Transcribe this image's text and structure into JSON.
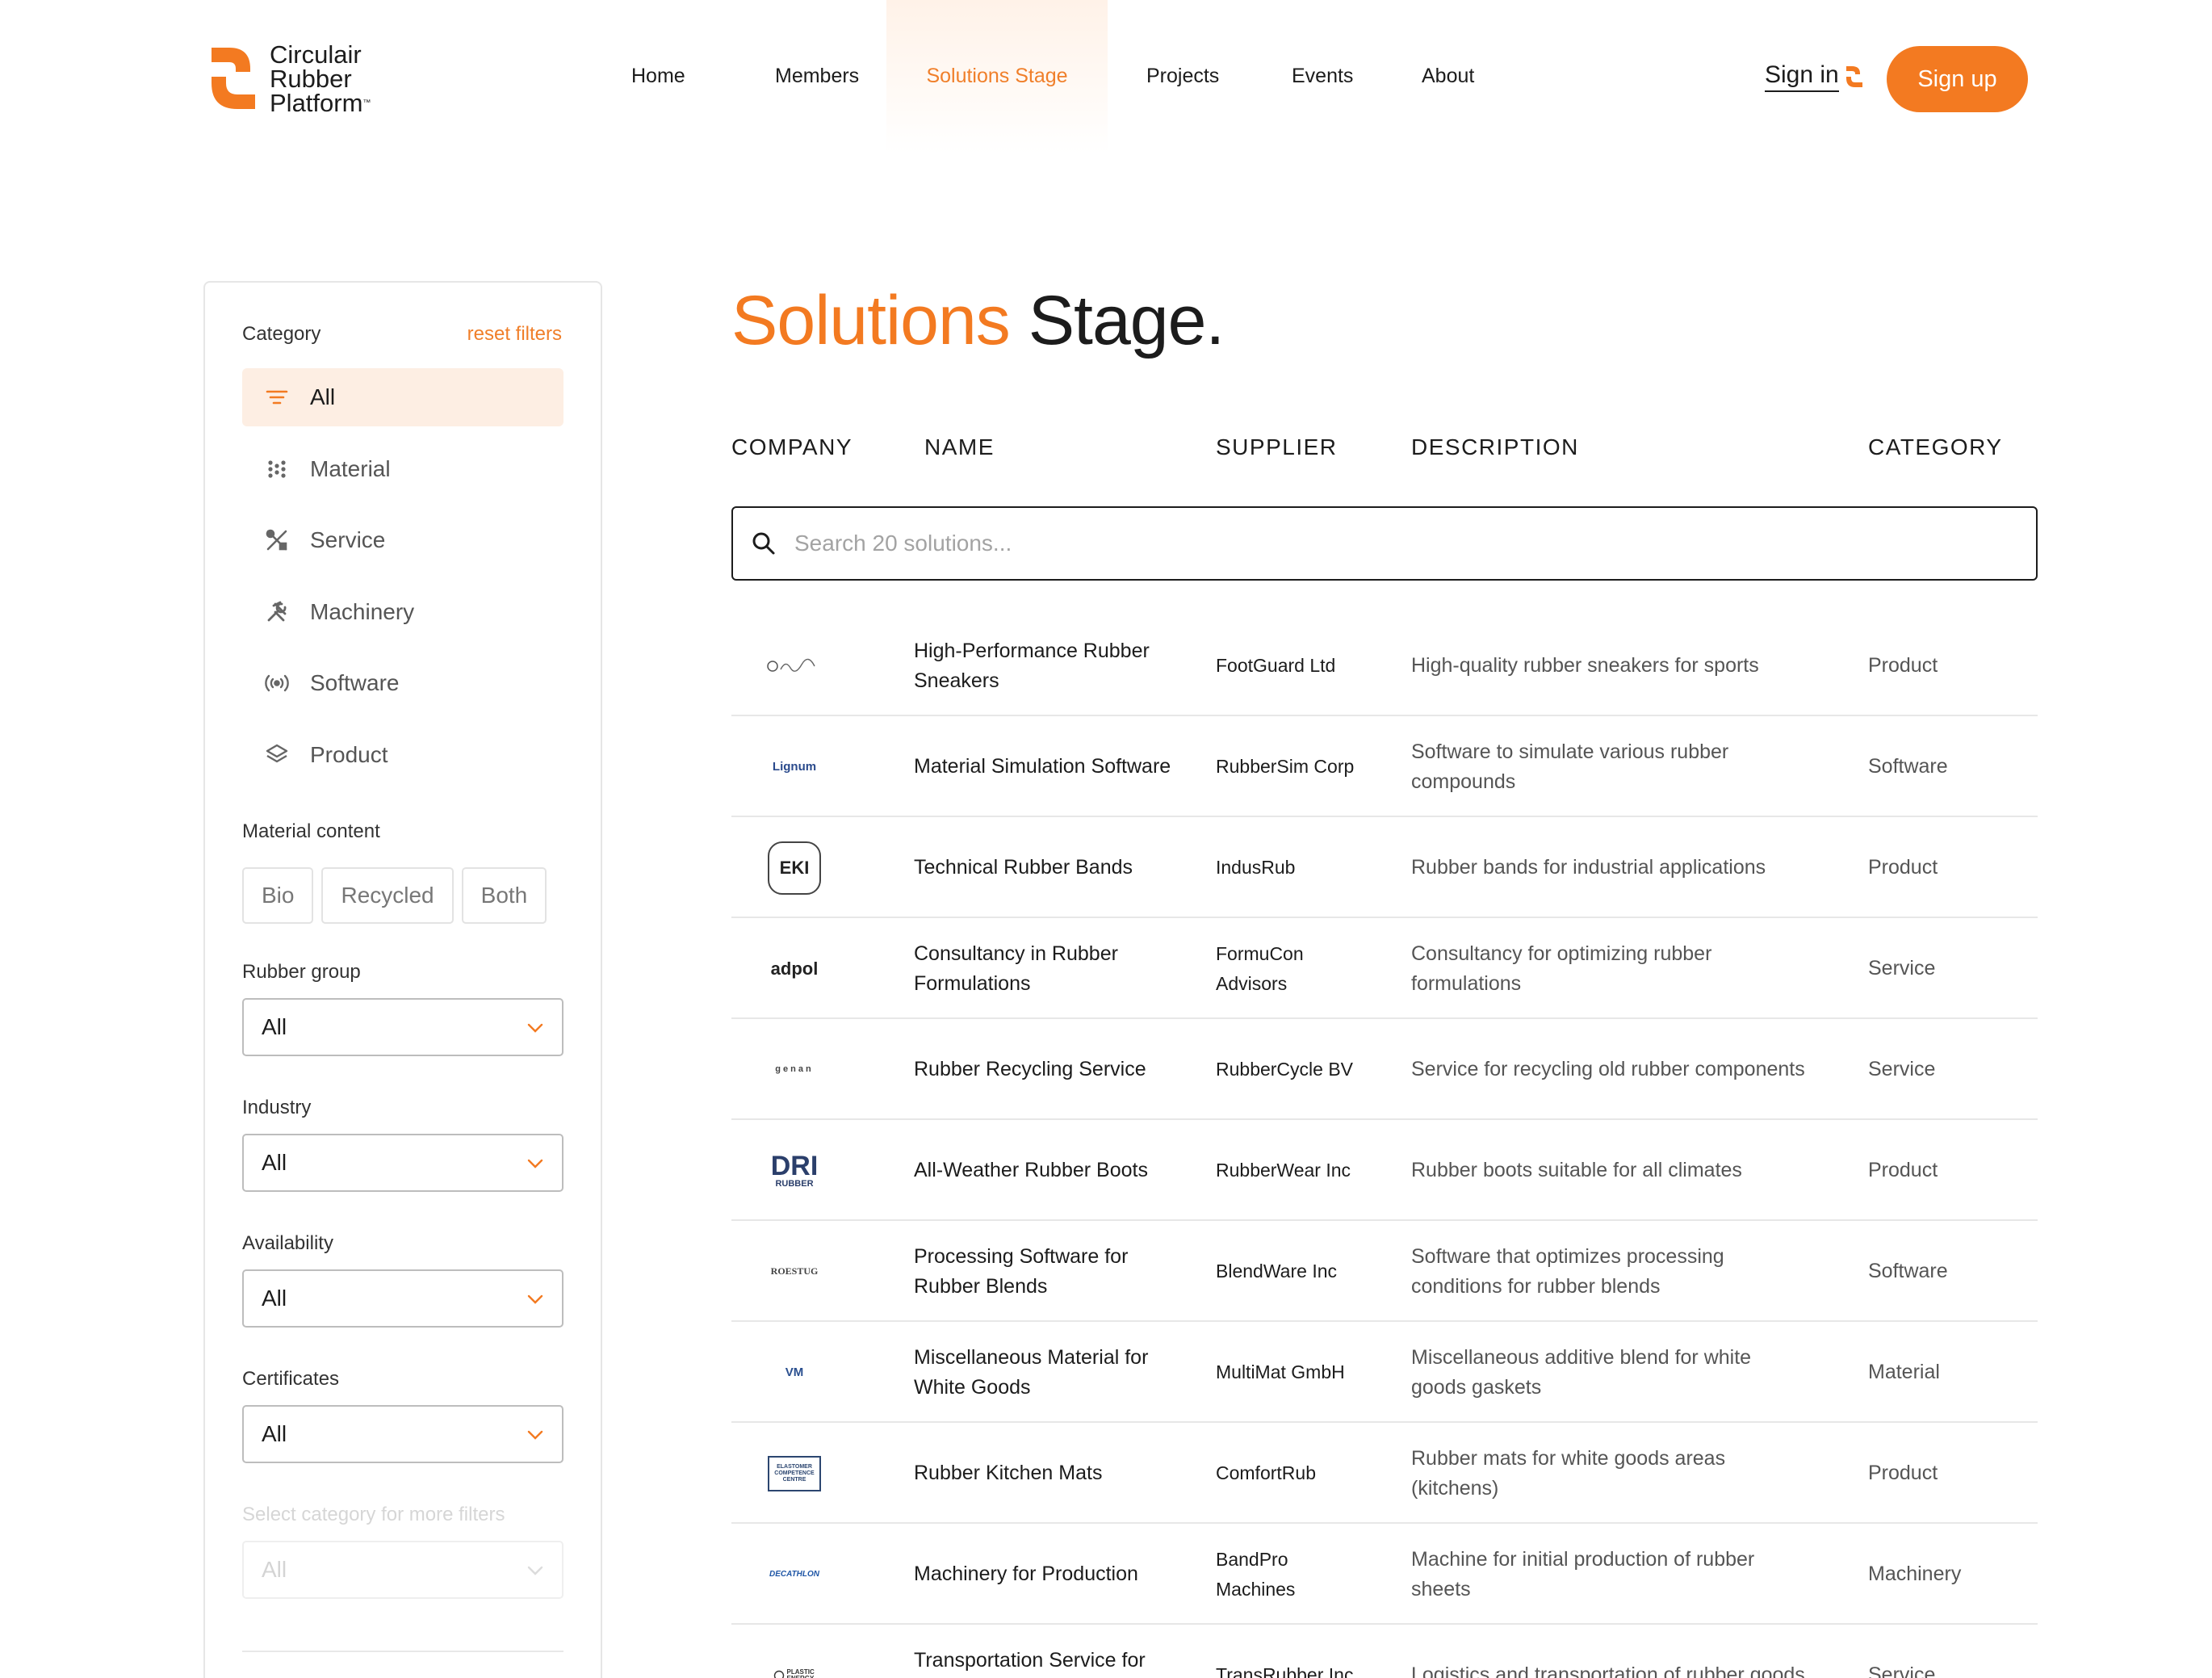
{
  "brand": {
    "line1": "Circulair",
    "line2": "Rubber",
    "line3": "Platform",
    "tm": "™",
    "accent": "#f37a21"
  },
  "nav": {
    "items": [
      {
        "label": "Home"
      },
      {
        "label": "Members"
      },
      {
        "label": "Solutions Stage",
        "active": true
      },
      {
        "label": "Projects"
      },
      {
        "label": "Events"
      },
      {
        "label": "About"
      }
    ],
    "sign_in": "Sign in",
    "sign_up": "Sign up"
  },
  "sidebar": {
    "category_label": "Category",
    "reset_label": "reset filters",
    "categories": [
      {
        "label": "All",
        "icon": "filter-lines-icon",
        "active": true
      },
      {
        "label": "Material",
        "icon": "dots-grid-icon"
      },
      {
        "label": "Service",
        "icon": "tools-crossed-icon"
      },
      {
        "label": "Machinery",
        "icon": "hammer-wrench-icon"
      },
      {
        "label": "Software",
        "icon": "broadcast-icon"
      },
      {
        "label": "Product",
        "icon": "layers-icon"
      }
    ],
    "material_content_label": "Material content",
    "material_options": [
      "Bio",
      "Recycled",
      "Both"
    ],
    "rubber_group": {
      "label": "Rubber group",
      "value": "All"
    },
    "industry": {
      "label": "Industry",
      "value": "All"
    },
    "availability": {
      "label": "Availability",
      "value": "All"
    },
    "certificates": {
      "label": "Certificates",
      "value": "All"
    },
    "more_filters": {
      "label": "Select category for more filters",
      "value": "All"
    }
  },
  "main": {
    "title_accent": "Solutions",
    "title_rest": " Stage.",
    "columns": [
      "COMPANY",
      "NAME",
      "SUPPLIER",
      "DESCRIPTION",
      "CATEGORY"
    ],
    "search_placeholder": "Search 20 solutions...",
    "rows": [
      {
        "logo": "signature-logo",
        "name": "High-Performance Rubber Sneakers",
        "supplier": "FootGuard Ltd",
        "description": "High-quality rubber sneakers for sports",
        "category": "Product"
      },
      {
        "logo": "lignum-logo",
        "logo_text": "Lignum",
        "name": "Material Simulation Software",
        "supplier": "RubberSim Corp",
        "description": "Software to simulate various rubber compounds",
        "category": "Software"
      },
      {
        "logo": "eki-logo",
        "logo_text": "EKI",
        "name": "Technical Rubber Bands",
        "supplier": "IndusRub",
        "description": "Rubber bands for industrial applications",
        "category": "Product"
      },
      {
        "logo": "adpol-logo",
        "logo_text": "adpol",
        "name": "Consultancy in Rubber Formulations",
        "supplier": "FormuCon Advisors",
        "description": "Consultancy for optimizing rubber formulations",
        "category": "Service"
      },
      {
        "logo": "genan-logo",
        "logo_text": "genan",
        "name": "Rubber Recycling Service",
        "supplier": "RubberCycle BV",
        "description": "Service for recycling old rubber components",
        "category": "Service"
      },
      {
        "logo": "dri-rubber-logo",
        "logo_text": "DRI",
        "logo_sub": "RUBBER",
        "name": "All-Weather Rubber Boots",
        "supplier": "RubberWear Inc",
        "description": "Rubber boots suitable for all climates",
        "category": "Product"
      },
      {
        "logo": "roestug-logo",
        "logo_text": "ROESTUG",
        "name": "Processing Software for Rubber Blends",
        "supplier": "BlendWare Inc",
        "description": "Software that optimizes processing conditions for rubber blends",
        "category": "Software"
      },
      {
        "logo": "vm-logo",
        "logo_text": "VM",
        "name": "Miscellaneous Material for White Goods",
        "supplier": "MultiMat GmbH",
        "description": "Miscellaneous additive blend for white goods gaskets",
        "category": "Material"
      },
      {
        "logo": "elastomer-logo",
        "logo_text": "ELASTOMER COMPETENCE CENTRE",
        "name": "Rubber Kitchen Mats",
        "supplier": "ComfortRub",
        "description": "Rubber mats for white goods areas (kitchens)",
        "category": "Product"
      },
      {
        "logo": "decathlon-logo",
        "logo_text": "DECATHLON",
        "name": "Machinery for Production",
        "supplier": "BandPro Machines",
        "description": "Machine for initial production of rubber sheets",
        "category": "Machinery"
      },
      {
        "logo": "plastic-energy-logo",
        "logo_text": "PLASTIC ENERGY",
        "name": "Transportation Service for Rubber Parts",
        "supplier": "TransRubber Inc",
        "description": "Logistics and transportation of rubber goods",
        "category": "Service"
      }
    ]
  }
}
